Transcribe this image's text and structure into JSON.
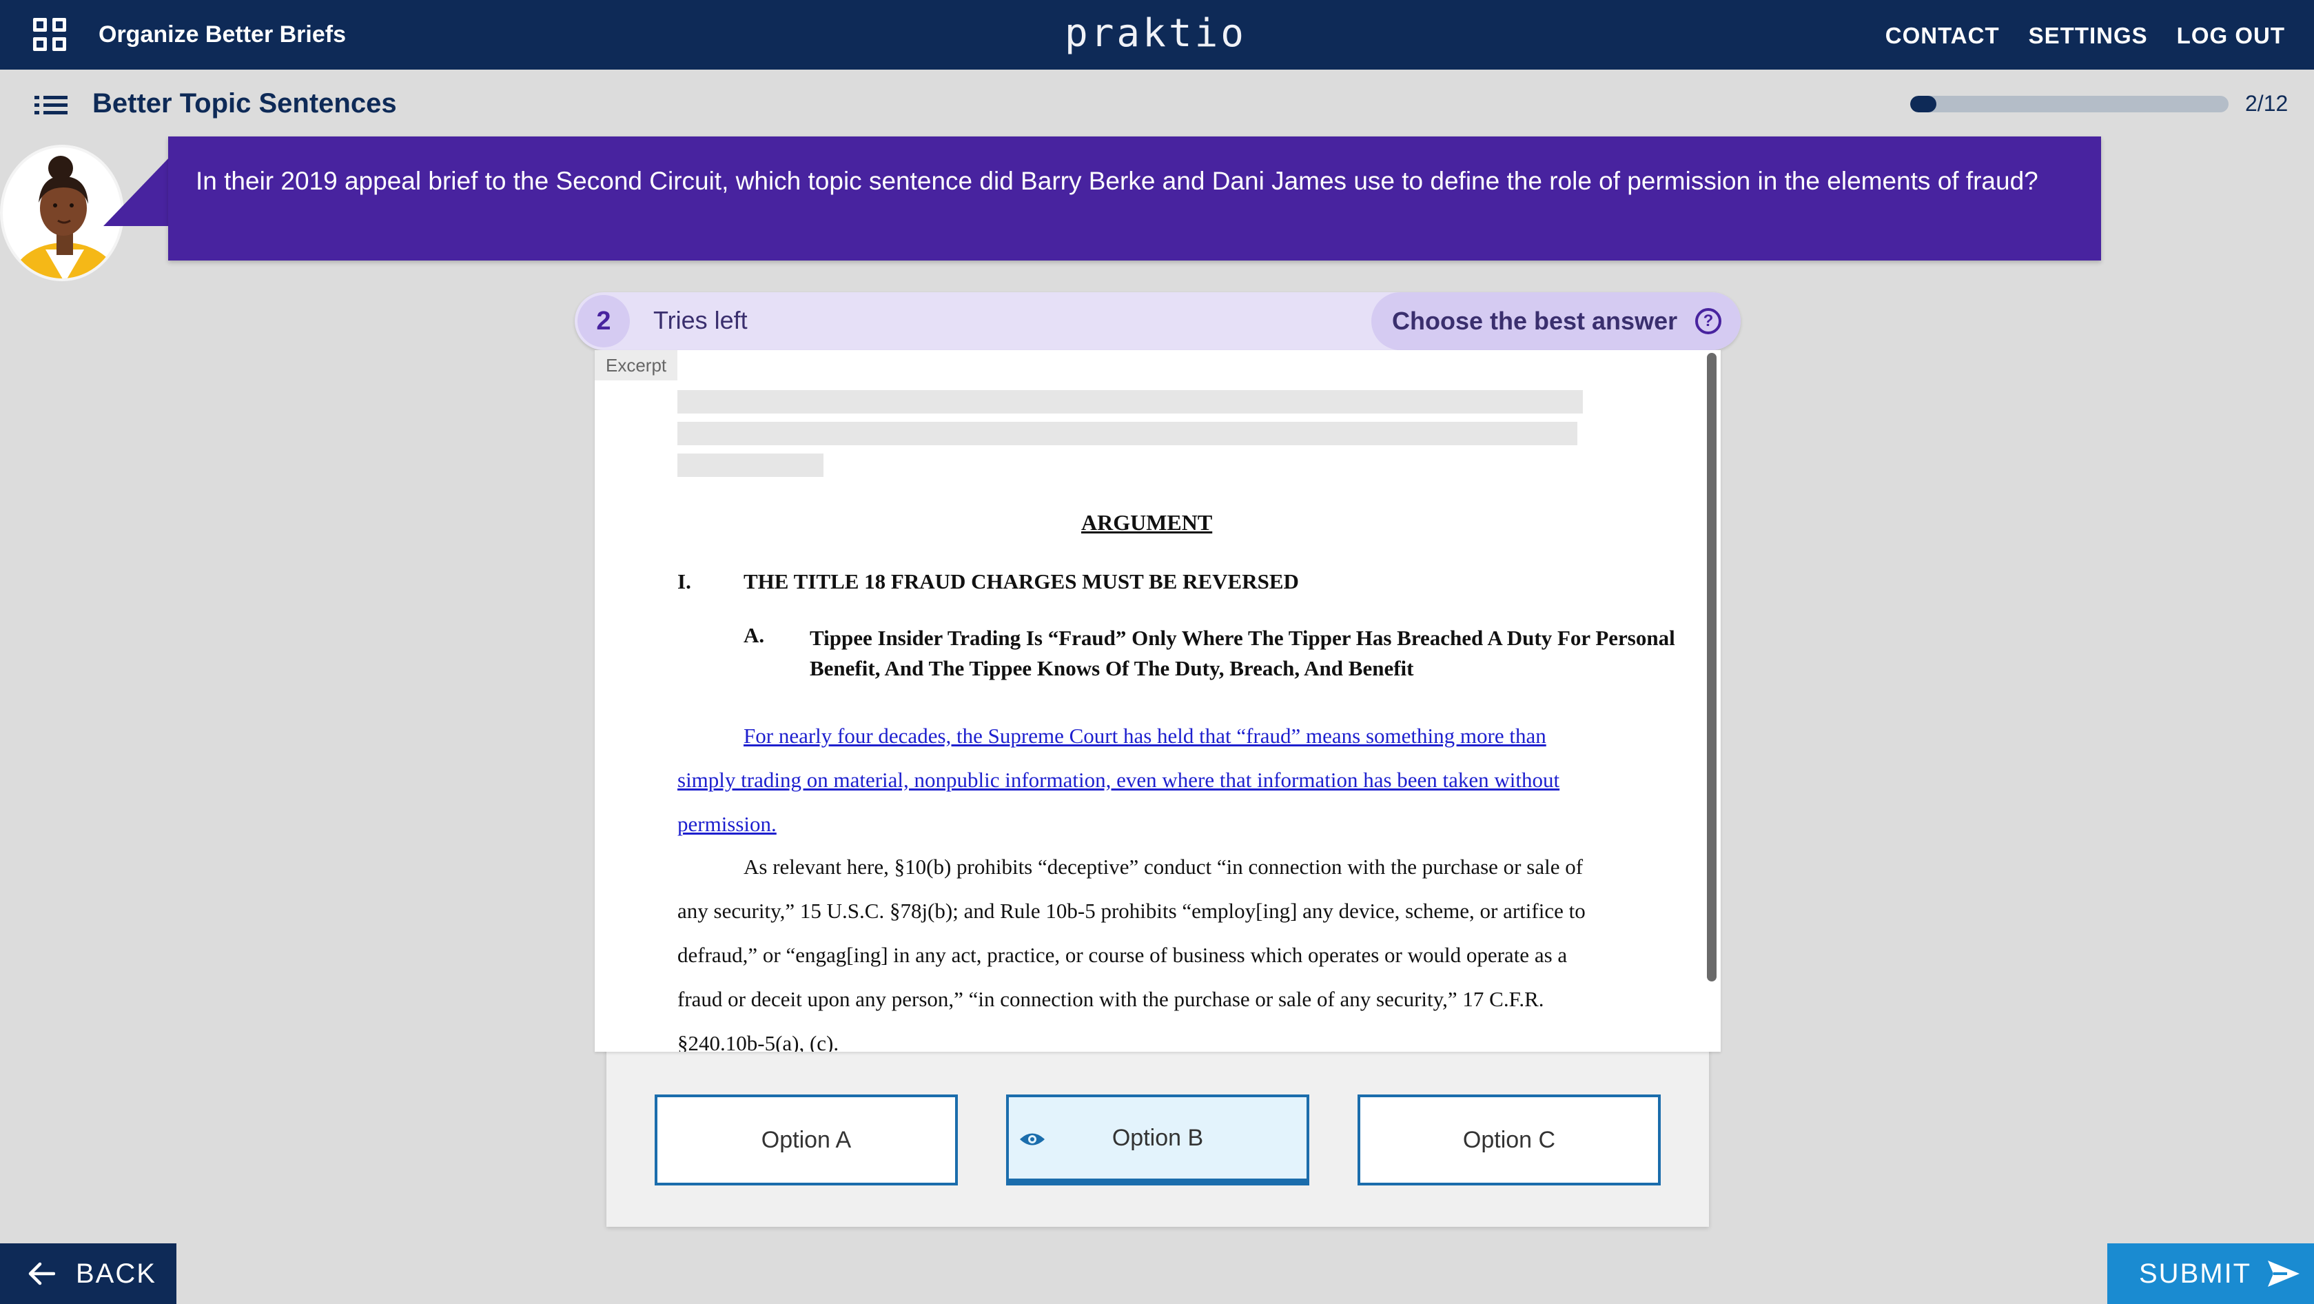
{
  "nav": {
    "course_title": "Organize Better Briefs",
    "brand": "praktio",
    "links": [
      "CONTACT",
      "SETTINGS",
      "LOG OUT"
    ]
  },
  "lesson": {
    "title": "Better Topic Sentences",
    "progress_text": "2/12",
    "progress_fraction": 0.083
  },
  "question": {
    "text": "In their 2019 appeal brief to the Second Circuit, which topic sentence did Barry Berke and Dani James use to define the role of permission in the elements of fraud?"
  },
  "tries": {
    "count": "2",
    "label": "Tries left",
    "instruction": "Choose the best answer"
  },
  "excerpt": {
    "tag": "Excerpt",
    "heading": "ARGUMENT",
    "section_number": "I.",
    "section_title": "THE TITLE 18 FRAUD CHARGES MUST BE REVERSED",
    "subsection_letter": "A.",
    "subsection_title": "Tippee Insider Trading Is “Fraud” Only Where The Tipper Has Breached A Duty For Personal Benefit, And The Tippee Knows Of The Duty, Breach, And Benefit",
    "topic_sentence": "For nearly four decades, the Supreme Court has held that “fraud” means something more than simply trading on material, nonpublic information, even where that information has been taken without permission.",
    "body": "As relevant here, §10(b) prohibits “deceptive” conduct “in connection with the purchase or sale of any security,” 15 U.S.C. §78j(b); and Rule 10b-5 prohibits “employ[ing] any device, scheme, or artifice to defraud,” or “engag[ing] in any act, practice, or course of business which operates or would operate as a fraud or deceit upon any person,” “in connection with the purchase or sale of any security,” 17 C.F.R. §240.10b-5(a), (c)."
  },
  "options": [
    {
      "label": "Option A",
      "selected": false
    },
    {
      "label": "Option B",
      "selected": true
    },
    {
      "label": "Option C",
      "selected": false
    }
  ],
  "footer": {
    "back_label": "BACK",
    "submit_label": "SUBMIT"
  },
  "colors": {
    "navy": "#0e2a57",
    "purple": "#48239f",
    "lavender": "#e6e0f7",
    "option_blue": "#1b6dac",
    "submit_blue": "#1a8bd1",
    "link_blue": "#1d1fce"
  },
  "icons": {
    "grid": "grid-icon",
    "list": "list-icon",
    "help": "help-icon",
    "eye": "eye-icon",
    "back": "arrow-left-icon",
    "submit": "send-icon"
  }
}
